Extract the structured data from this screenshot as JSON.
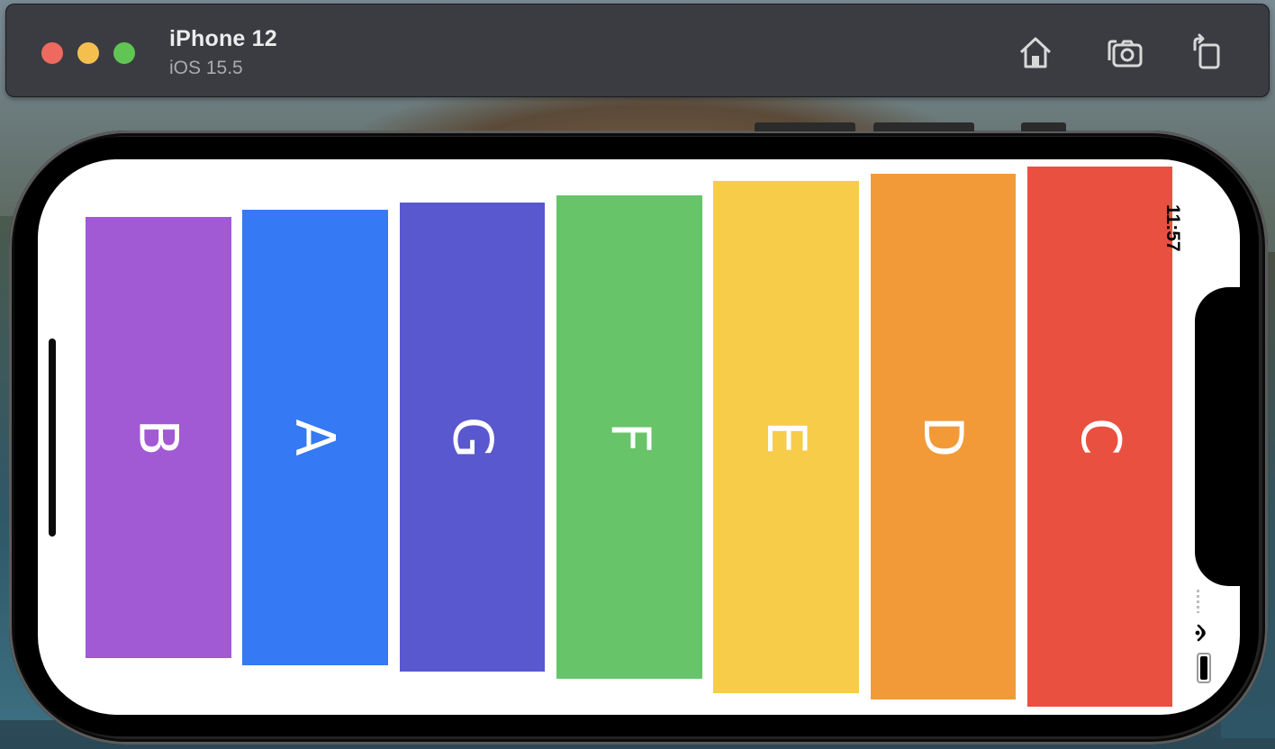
{
  "window": {
    "device_name": "iPhone 12",
    "os_version": "iOS 15.5",
    "toolbar_icons": [
      "home-icon",
      "screenshot-icon",
      "rotate-icon"
    ]
  },
  "status_bar": {
    "time": "11:57",
    "icons": [
      "wifi-icon",
      "battery-icon"
    ]
  },
  "cards": [
    {
      "label": "B",
      "color": "#a259d4"
    },
    {
      "label": "A",
      "color": "#3579f4"
    },
    {
      "label": "G",
      "color": "#5958cf"
    },
    {
      "label": "F",
      "color": "#67c469"
    },
    {
      "label": "E",
      "color": "#f6cc49"
    },
    {
      "label": "D",
      "color": "#f29a38"
    },
    {
      "label": "C",
      "color": "#ea503f"
    }
  ]
}
